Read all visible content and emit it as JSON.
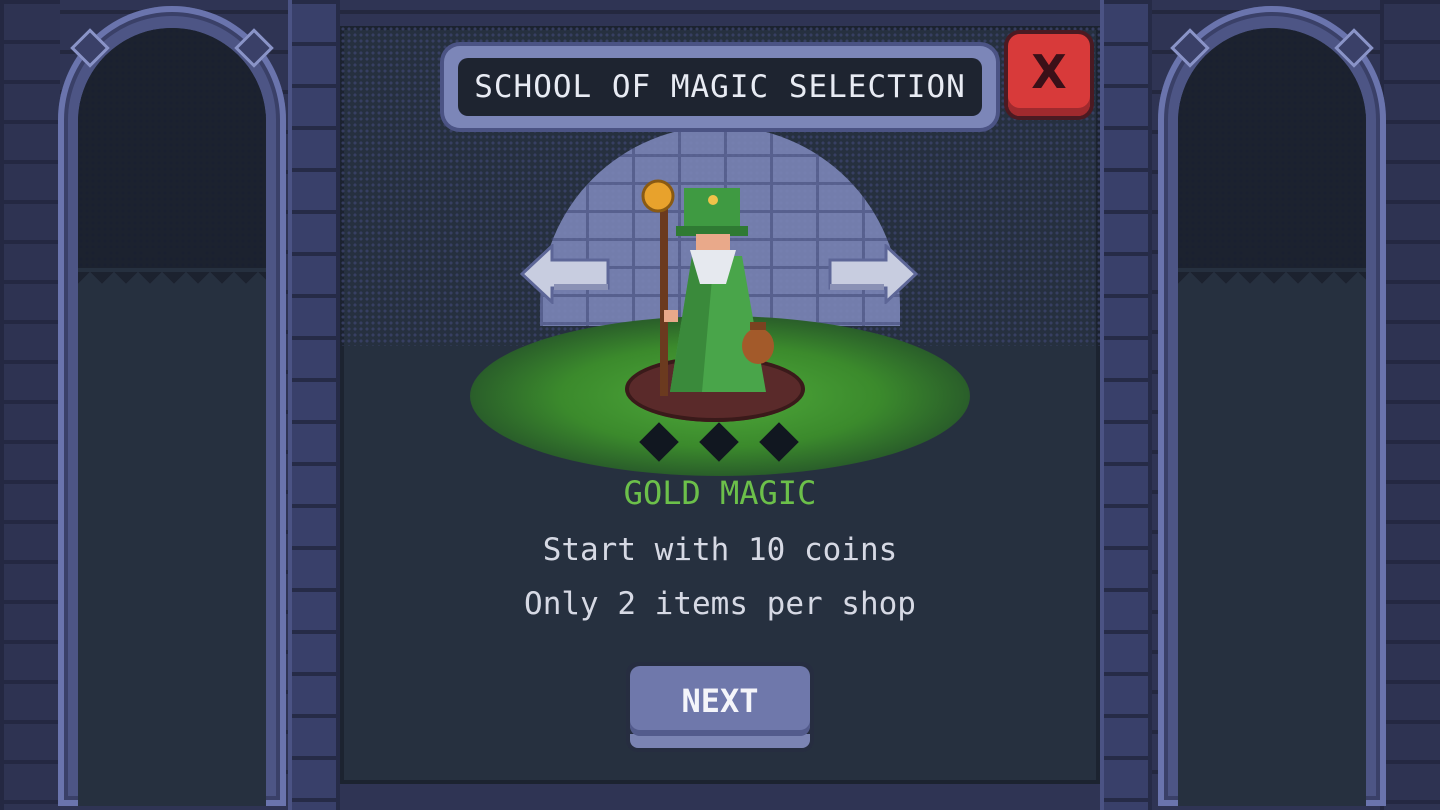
{
  "dialog": {
    "title": "SCHOOL OF MAGIC SELECTION",
    "close_label": "X"
  },
  "selection": {
    "school_name": "GOLD MAGIC",
    "description_lines": [
      "Start with 10 coins",
      "Only 2 items per shop"
    ],
    "character_icon": "green-wizard-with-staff-and-coin-bag",
    "difficulty_gems": 3
  },
  "navigation": {
    "prev_icon": "arrow-left-icon",
    "next_icon": "arrow-right-icon"
  },
  "actions": {
    "next_label": "NEXT"
  },
  "colors": {
    "school_name": "#6cc04a",
    "close_button": "#d83a3a",
    "next_button": "#6f78ab",
    "panel_bg": "#26303f",
    "text": "#d6d9e4"
  }
}
